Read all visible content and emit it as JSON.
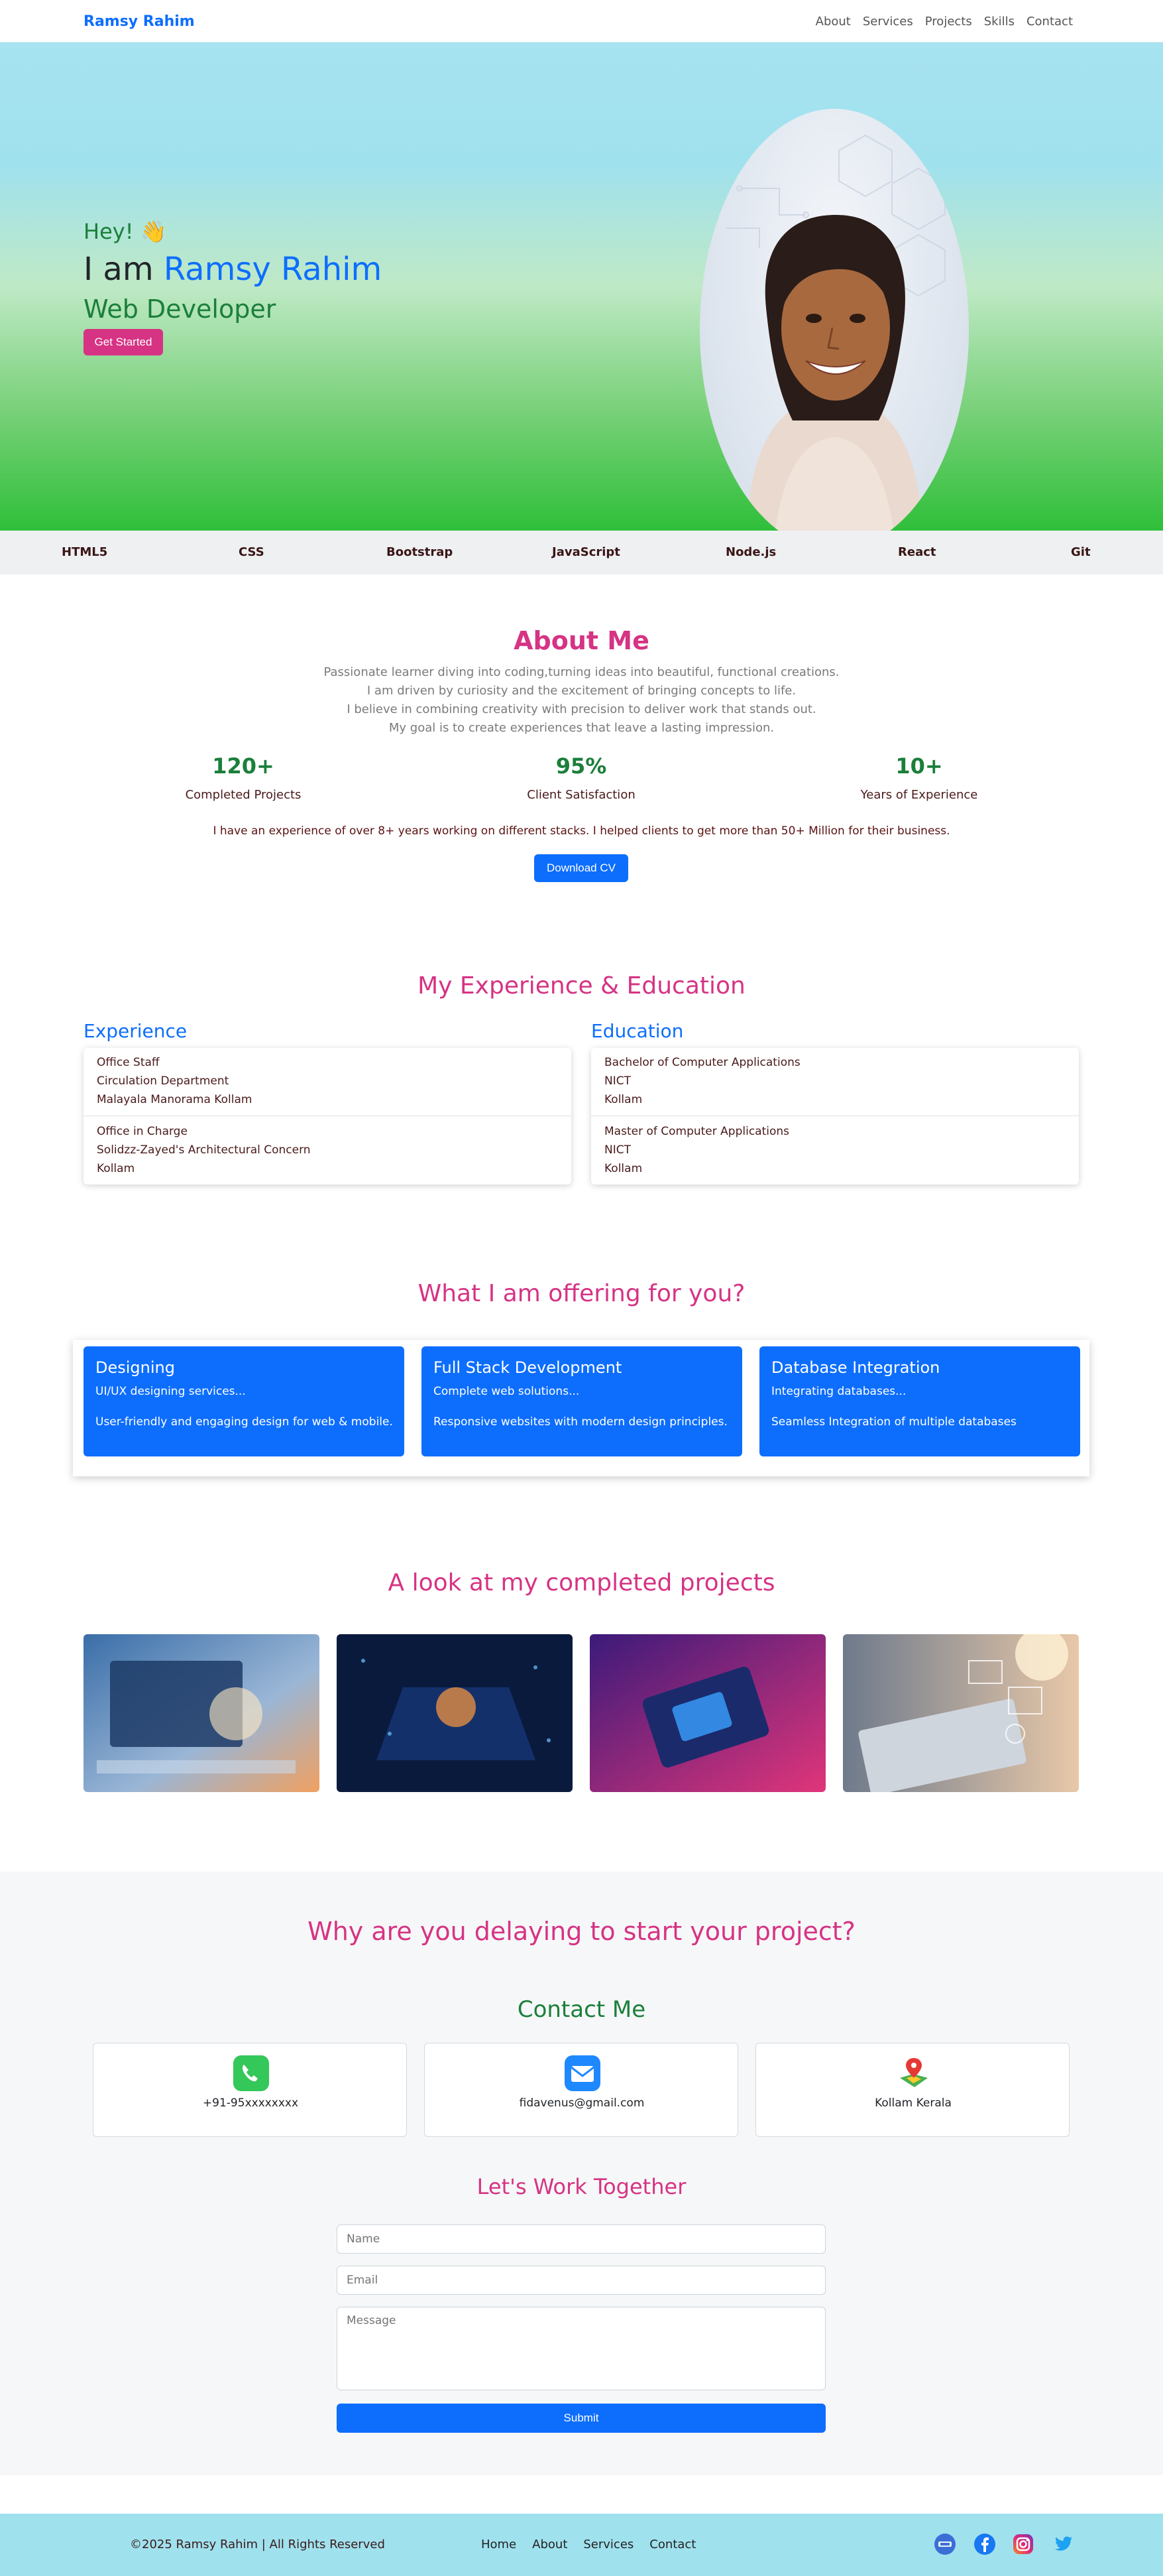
{
  "navbar": {
    "brand": "Ramsy Rahim",
    "links": [
      "About",
      "Services",
      "Projects",
      "Skills",
      "Contact"
    ]
  },
  "hero": {
    "greeting": "Hey! 👋",
    "intro_prefix": "I am",
    "name": "Ramsy Rahim",
    "role": "Web Developer",
    "cta": "Get Started"
  },
  "skills": [
    "HTML5",
    "CSS",
    "Bootstrap",
    "JavaScript",
    "Node.js",
    "React",
    "Git"
  ],
  "about": {
    "title": "About Me",
    "lines": [
      "Passionate learner diving into coding,turning ideas into beautiful, functional creations.",
      "I am driven by curiosity and the excitement of bringing concepts to life.",
      "I believe in combining creativity with precision to deliver work that stands out.",
      "My goal is to create experiences that leave a lasting impression."
    ],
    "stats": [
      {
        "value": "120+",
        "label": "Completed Projects"
      },
      {
        "value": "95%",
        "label": "Client Satisfaction"
      },
      {
        "value": "10+",
        "label": "Years of Experience"
      }
    ],
    "experience_note": "I have an experience of over 8+ years working on different stacks. I helped clients to get more than 50+ Million for their business.",
    "cv_button": "Download CV"
  },
  "exp_edu": {
    "title": "My Experience & Education",
    "experience_heading": "Experience",
    "education_heading": "Education",
    "experience": [
      [
        "Office Staff",
        "Circulation Department",
        "Malayala Manorama Kollam"
      ],
      [
        "Office in Charge",
        "Solidzz-Zayed's Architectural Concern",
        "Kollam"
      ]
    ],
    "education": [
      [
        "Bachelor of Computer Applications",
        "NICT",
        "Kollam"
      ],
      [
        "Master of Computer Applications",
        "NICT",
        "Kollam"
      ]
    ]
  },
  "offering": {
    "title": "What I am offering for you?",
    "cards": [
      {
        "title": "Designing",
        "sub": "UI/UX designing services...",
        "desc": "User-friendly and engaging design for web & mobile."
      },
      {
        "title": "Full Stack Development",
        "sub": "Complete web solutions...",
        "desc": "Responsive websites with modern design principles."
      },
      {
        "title": "Database Integration",
        "sub": "Integrating databases...",
        "desc": "Seamless Integration of multiple databases"
      }
    ]
  },
  "projects": {
    "title": "A look at my completed projects"
  },
  "contact": {
    "delay_title": "Why are you delaying to start your project?",
    "title": "Contact Me",
    "phone": "+91-95xxxxxxxx",
    "email": "fidavenus@gmail.com",
    "location": "Kollam Kerala",
    "work_title": "Let's Work Together",
    "name_placeholder": "Name",
    "email_placeholder": "Email",
    "message_placeholder": "Message",
    "submit": "Submit"
  },
  "footer": {
    "copyright": "©2025 Ramsy Rahim | All Rights Reserved",
    "links": [
      "Home",
      "About",
      "Services",
      "Contact"
    ]
  },
  "colors": {
    "primary": "#0d6efd",
    "accent_pink": "#d63384",
    "green": "#1b7f3a",
    "footer_bg": "#a0e1ee"
  }
}
